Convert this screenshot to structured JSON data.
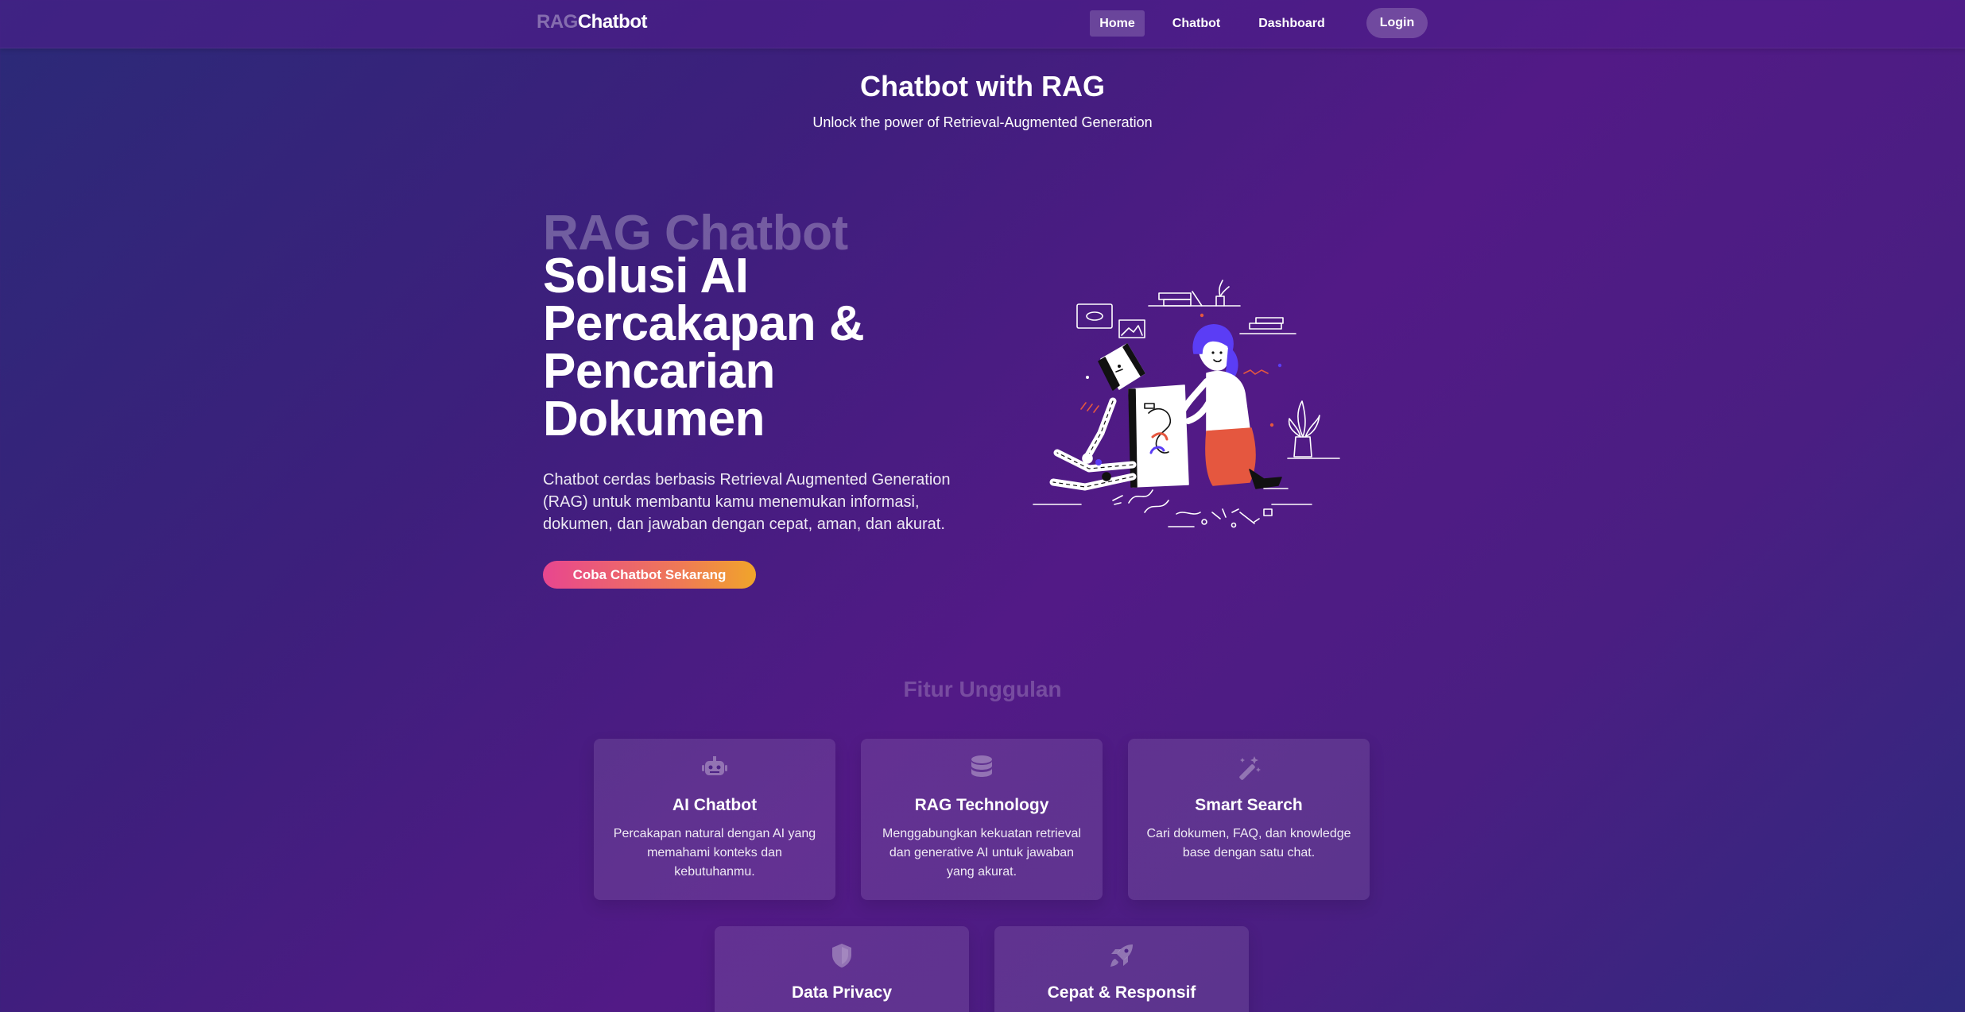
{
  "nav": {
    "brand_prefix": "RAG",
    "brand_suffix": "Chatbot",
    "items": [
      {
        "label": "Home",
        "active": true
      },
      {
        "label": "Chatbot"
      },
      {
        "label": "Dashboard"
      }
    ],
    "login_label": "Login"
  },
  "header": {
    "title": "Chatbot with RAG",
    "subtitle": "Unlock the power of Retrieval-Augmented Generation"
  },
  "hero": {
    "eyebrow": "RAG Chatbot",
    "title": "Solusi AI Percakapan & Pencarian Dokumen",
    "description": "Chatbot cerdas berbasis Retrieval Augmented Generation (RAG) untuk membantu kamu menemukan informasi, dokumen, dan jawaban dengan cepat, aman, dan akurat.",
    "cta_label": "Coba Chatbot Sekarang"
  },
  "features": {
    "title": "Fitur Unggulan",
    "items": [
      {
        "icon": "robot-icon",
        "title": "AI Chatbot",
        "description": "Percakapan natural dengan AI yang memahami konteks dan kebutuhanmu."
      },
      {
        "icon": "database-icon",
        "title": "RAG Technology",
        "description": "Menggabungkan kekuatan retrieval dan generative AI untuk jawaban yang akurat."
      },
      {
        "icon": "magic-wand-icon",
        "title": "Smart Search",
        "description": "Cari dokumen, FAQ, dan knowledge base dengan satu chat."
      },
      {
        "icon": "shield-icon",
        "title": "Data Privacy",
        "description": ""
      },
      {
        "icon": "rocket-icon",
        "title": "Cepat & Responsif",
        "description": ""
      }
    ]
  },
  "colors": {
    "background_start": "#2b2a78",
    "background_mid": "#521a86",
    "cta_start": "#e8468f",
    "cta_end": "#f0a52a",
    "illustration_accent": "#5b3df5",
    "illustration_skirt": "#e5573f"
  }
}
